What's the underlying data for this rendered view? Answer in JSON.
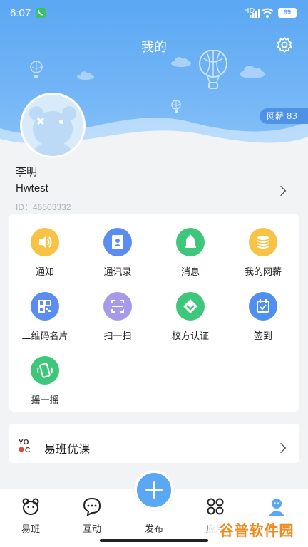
{
  "status_bar": {
    "time": "6:07",
    "signal_label": "HD",
    "battery": "99"
  },
  "header": {
    "title": "我的"
  },
  "points_badge": "网薪 83",
  "profile": {
    "name": "李明",
    "account": "Hwtest",
    "id": "ID：46503332"
  },
  "grid": [
    {
      "label": "通知",
      "icon": "speaker-icon",
      "color": "#f6c347"
    },
    {
      "label": "通讯录",
      "icon": "contacts-icon",
      "color": "#5b8df0"
    },
    {
      "label": "消息",
      "icon": "bell-icon",
      "color": "#3ec67a"
    },
    {
      "label": "我的网薪",
      "icon": "coin-stack-icon",
      "color": "#f6c347"
    },
    {
      "label": "二维码名片",
      "icon": "qr-code-icon",
      "color": "#5b8df0"
    },
    {
      "label": "扫一扫",
      "icon": "scan-icon",
      "color": "#a79ae8"
    },
    {
      "label": "校方认证",
      "icon": "verified-icon",
      "color": "#3ec67a"
    },
    {
      "label": "签到",
      "icon": "calendar-check-icon",
      "color": "#4e8ff0"
    },
    {
      "label": "摇一摇",
      "icon": "shake-phone-icon",
      "color": "#3ec67a"
    }
  ],
  "course": {
    "logo_text": "YO C",
    "label": "易班优课"
  },
  "tabbar": {
    "items": [
      {
        "label": "易班",
        "icon": "bear-icon"
      },
      {
        "label": "互动",
        "icon": "chat-bubble-icon"
      },
      {
        "label": "发布",
        "icon": "plus-icon"
      },
      {
        "label": "应用",
        "icon": "apps-icon"
      },
      {
        "label": "我的",
        "icon": "person-icon"
      }
    ]
  },
  "watermark": "谷普软件园",
  "colors": {
    "header_blue": "#5ba7f3",
    "accent_blue": "#5aa7f3"
  }
}
